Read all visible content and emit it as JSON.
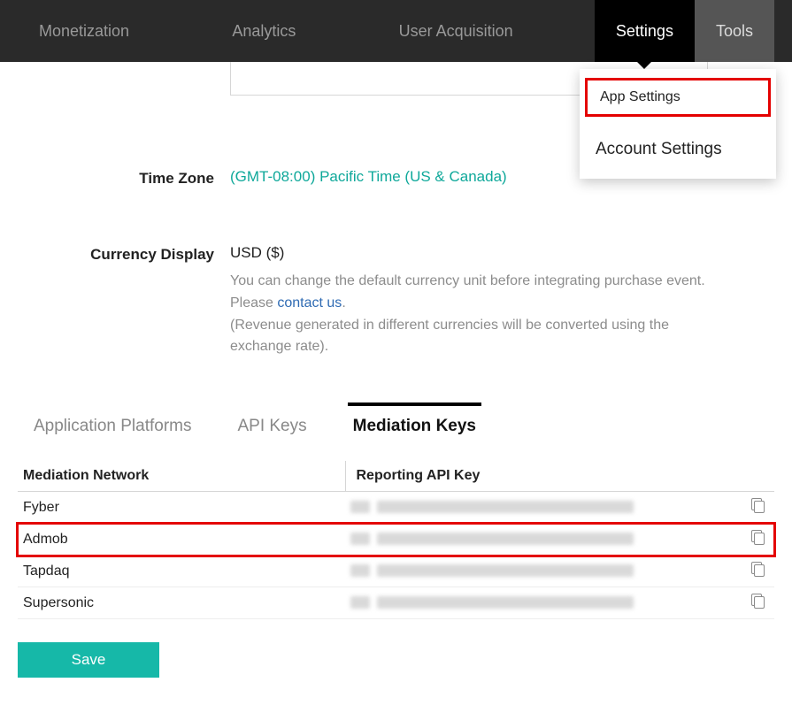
{
  "nav": {
    "items": [
      "Monetization",
      "Analytics",
      "User Acquisition",
      "Settings",
      "Tools"
    ],
    "active_index": 3
  },
  "dropdown": {
    "items": [
      "App Settings",
      "Account Settings"
    ],
    "highlighted_index": 0
  },
  "fields": {
    "timezone_label": "Time Zone",
    "timezone_value": "(GMT-08:00) Pacific Time (US & Canada)",
    "currency_label": "Currency Display",
    "currency_value": "USD ($)",
    "currency_help_1": "You can change the default currency unit before integrating purchase event. Please ",
    "contact_us": "contact us",
    "currency_help_2": ".",
    "currency_help_3": "(Revenue generated in different currencies will be converted using the exchange rate)."
  },
  "tabs": {
    "items": [
      "Application Platforms",
      "API Keys",
      "Mediation Keys"
    ],
    "active_index": 2
  },
  "mediation": {
    "col_network": "Mediation Network",
    "col_key": "Reporting API Key",
    "rows": [
      {
        "network": "Fyber"
      },
      {
        "network": "Admob"
      },
      {
        "network": "Tapdaq"
      },
      {
        "network": "Supersonic"
      }
    ],
    "highlighted_index": 1
  },
  "save_label": "Save"
}
